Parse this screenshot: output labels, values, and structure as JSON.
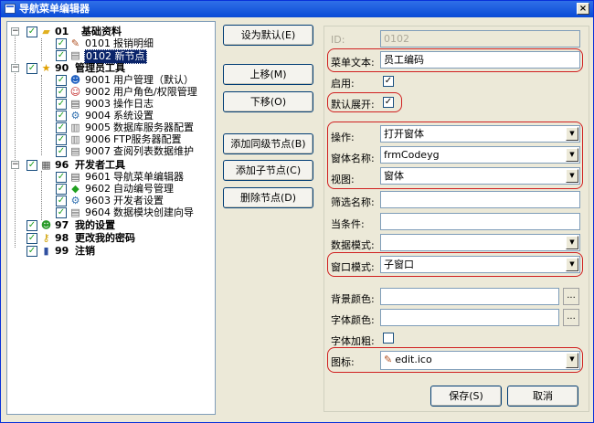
{
  "window": {
    "title": "导航菜单编辑器",
    "close": "×"
  },
  "tree": {
    "nodes": [
      {
        "code": "01",
        "text": "基础资料"
      },
      {
        "code": "0101",
        "text": "报销明细"
      },
      {
        "code": "0102",
        "text": "新节点"
      },
      {
        "code": "90",
        "text": "管理员工具"
      },
      {
        "code": "9001",
        "text": "用户管理（默认）"
      },
      {
        "code": "9002",
        "text": "用户角色/权限管理"
      },
      {
        "code": "9003",
        "text": "操作日志"
      },
      {
        "code": "9004",
        "text": "系统设置"
      },
      {
        "code": "9005",
        "text": "数据库服务器配置"
      },
      {
        "code": "9006",
        "text": "FTP服务器配置"
      },
      {
        "code": "9007",
        "text": "查阅列表数据维护"
      },
      {
        "code": "96",
        "text": "开发者工具"
      },
      {
        "code": "9601",
        "text": "导航菜单编辑器"
      },
      {
        "code": "9602",
        "text": "自动编号管理"
      },
      {
        "code": "9603",
        "text": "开发者设置"
      },
      {
        "code": "9604",
        "text": "数据模块创建向导"
      },
      {
        "code": "97",
        "text": "我的设置"
      },
      {
        "code": "98",
        "text": "更改我的密码"
      },
      {
        "code": "99",
        "text": "注销"
      }
    ]
  },
  "buttons": {
    "set_default": "设为默认(E)",
    "move_up": "上移(M)",
    "move_down": "下移(O)",
    "add_sibling": "添加同级节点(B)",
    "add_child": "添加子节点(C)",
    "delete_node": "删除节点(D)",
    "save": "保存(S)",
    "cancel": "取消"
  },
  "form": {
    "id_label": "ID:",
    "id_value": "0102",
    "menu_text_label": "菜单文本:",
    "menu_text_value": "员工编码",
    "enabled_label": "启用:",
    "default_expand_label": "默认展开:",
    "action_label": "操作:",
    "action_value": "打开窗体",
    "form_name_label": "窗体名称:",
    "form_name_value": "frmCodeyg",
    "view_label": "视图:",
    "view_value": "窗体",
    "filter_name_label": "筛选名称:",
    "where_label": "当条件:",
    "data_mode_label": "数据模式:",
    "window_mode_label": "窗口模式:",
    "window_mode_value": "子窗口",
    "bg_color_label": "背景颜色:",
    "font_color_label": "字体颜色:",
    "bold_label": "字体加粗:",
    "icon_label": "图标:",
    "icon_value": "edit.ico",
    "browse": "..."
  },
  "colors": {
    "title_bar": "#0a4bd6",
    "highlight": "#d02020",
    "selected": "#0a246a"
  }
}
